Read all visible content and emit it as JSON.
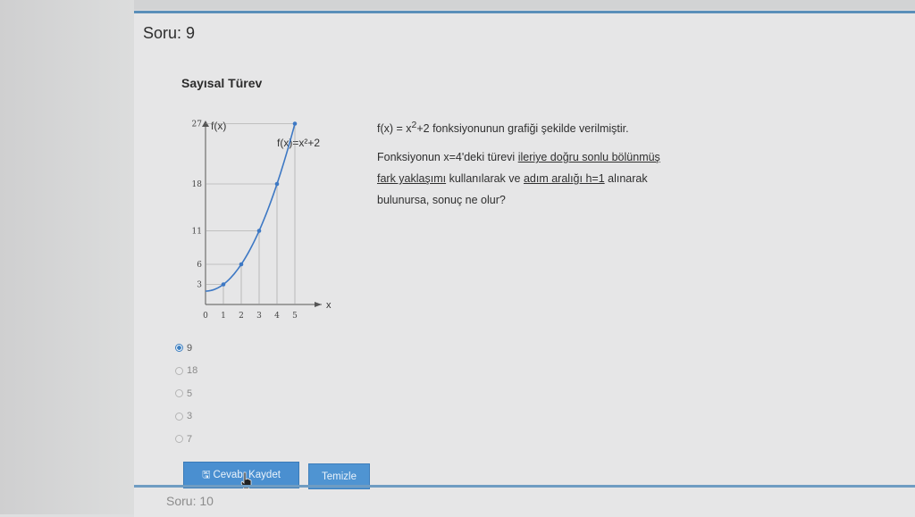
{
  "question": {
    "title": "Soru: 9",
    "subject": "Sayısal Türev",
    "line1_pre": "f(x) = x",
    "line1_sup": "2",
    "line1_post": "+2 fonksiyonunun grafiği şekilde verilmiştir.",
    "line2_a": "Fonksiyonun x=4'deki türevi ",
    "line2_b": "ileriye doğru sonlu bölünmüş",
    "line3_a": "fark yaklaşımı",
    "line3_b": " kullanılarak ve ",
    "line3_c": "adım aralığı h=1",
    "line3_d": "  alınarak",
    "line4": "bulunursa, sonuç ne olur?"
  },
  "figure": {
    "y_axis_label": "f(x)",
    "x_axis_label": "x",
    "curve_label": "f(x)=x²+2",
    "y_ticks": [
      "27",
      "18",
      "11",
      "6",
      "3"
    ],
    "x_ticks": [
      "0",
      "1",
      "2",
      "3",
      "4",
      "5"
    ],
    "points": [
      [
        1,
        3
      ],
      [
        2,
        6
      ],
      [
        3,
        11
      ],
      [
        4,
        18
      ],
      [
        5,
        27
      ]
    ]
  },
  "options": [
    {
      "label": "9",
      "selected": true
    },
    {
      "label": "18",
      "selected": false
    },
    {
      "label": "5",
      "selected": false
    },
    {
      "label": "3",
      "selected": false
    },
    {
      "label": "7",
      "selected": false
    }
  ],
  "buttons": {
    "save_icon": "floppy-disk-icon",
    "save_label": "Cevabı Kaydet",
    "clear_label": "Temizle"
  },
  "next": {
    "title": "Soru: 10"
  },
  "colors": {
    "accent": "#4a8fd0",
    "rule": "#5a8fb9",
    "curve": "#3d78c4"
  }
}
